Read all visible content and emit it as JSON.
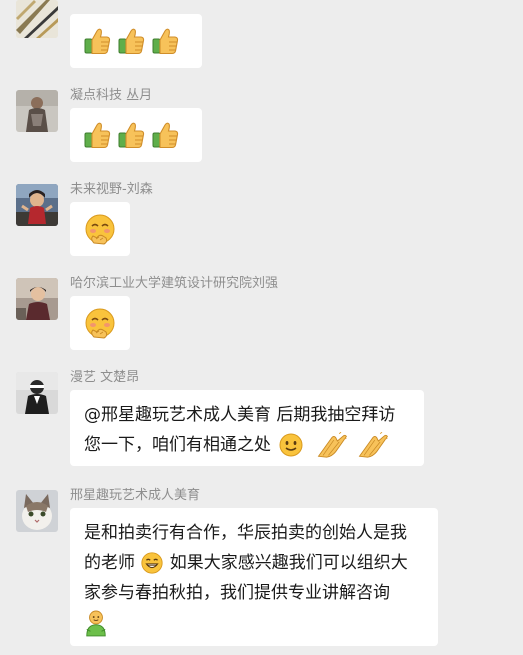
{
  "messages": [
    {
      "id": "m0",
      "sender": "",
      "content": {
        "type": "emoji",
        "emojis": [
          "thumbs-up",
          "thumbs-up",
          "thumbs-up"
        ]
      }
    },
    {
      "id": "m1",
      "sender": "凝点科技 丛月",
      "content": {
        "type": "emoji",
        "emojis": [
          "thumbs-up",
          "thumbs-up",
          "thumbs-up"
        ]
      }
    },
    {
      "id": "m2",
      "sender": "未来视野-刘森",
      "content": {
        "type": "emoji",
        "emojis": [
          "shy-face"
        ]
      }
    },
    {
      "id": "m3",
      "sender": "哈尔滨工业大学建筑设计研究院刘强",
      "content": {
        "type": "emoji",
        "emojis": [
          "shy-face"
        ]
      }
    },
    {
      "id": "m4",
      "sender": "漫艺 文楚昂",
      "content": {
        "type": "text",
        "line1": "@邢星趣玩艺术成人美育 后期我抽空拜访",
        "line2": "您一下，咱们有相通之处",
        "trailing_emojis": [
          "smile-face",
          "clap",
          "clap"
        ]
      }
    },
    {
      "id": "m5",
      "sender": "邢星趣玩艺术成人美育",
      "content": {
        "type": "text",
        "line1": "是和拍卖行有合作，华辰拍卖的创始人是我",
        "line2a": "的老师",
        "line2_emoji": "grin-face",
        "line2b": " 如果大家感兴趣我们可以组织大",
        "line3": "家参与春拍秋拍，我们提供专业讲解咨询",
        "line4_emoji": "green-person"
      }
    }
  ],
  "colors": {
    "background": "#ededed",
    "bubble": "#ffffff",
    "sender_text": "#8e8e8e",
    "message_text": "#1a1a1a",
    "emoji_yellow": "#f9c33c"
  }
}
